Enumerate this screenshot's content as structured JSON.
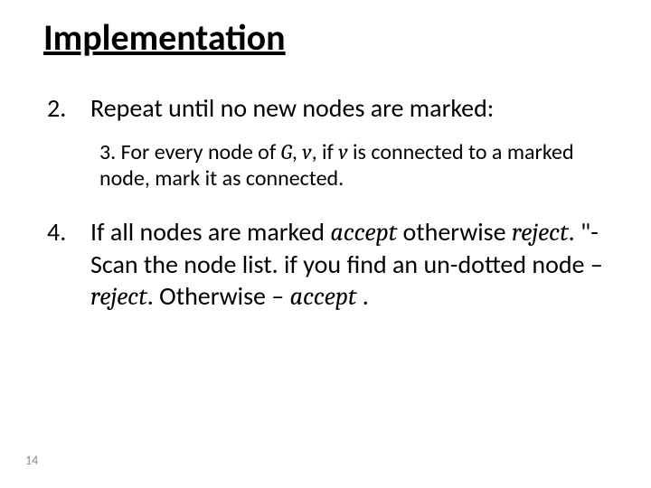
{
  "title": "Implementation",
  "item2": {
    "num": "2.",
    "text": "Repeat until no new nodes are marked:"
  },
  "item3": {
    "prefix": "3. For every node of ",
    "G": "G",
    "sep1": ", ",
    "v1": "v",
    "mid": ", if ",
    "v2": "v",
    "rest": " is connected to a marked node, mark it as connected."
  },
  "item4": {
    "num": "4.",
    "a": "If all nodes are marked ",
    "accept1": "accept",
    "b": " otherwise ",
    "reject1": "reject",
    "c": ". \"-",
    "d": "Scan the node list. if you find an un-dotted node – ",
    "reject2": "reject",
    "e": ". Otherwise – ",
    "accept2": "accept",
    "f": " ."
  },
  "page": "14"
}
